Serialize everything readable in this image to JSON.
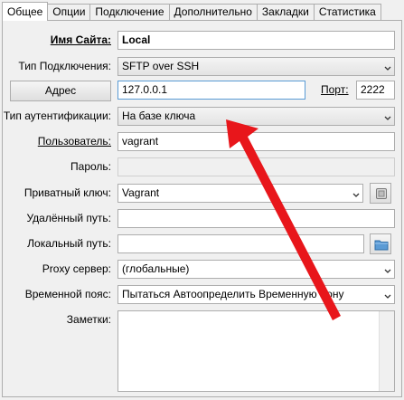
{
  "tabs": [
    "Общее",
    "Опции",
    "Подключение",
    "Дополнительно",
    "Закладки",
    "Статистика"
  ],
  "form": {
    "site_name_label": "Имя Сайта:",
    "site_name_value": "Local",
    "conn_type_label": "Тип Подключения:",
    "conn_type_value": "SFTP over SSH",
    "address_button": "Адрес",
    "address_value": "127.0.0.1",
    "port_label": "Порт:",
    "port_value": "2222",
    "auth_type_label": "Тип аутентификации:",
    "auth_type_value": "На базе ключа",
    "user_label": "Пользователь:",
    "user_value": "vagrant",
    "password_label": "Пароль:",
    "private_key_label": "Приватный ключ:",
    "private_key_value": "Vagrant",
    "remote_path_label": "Удалённый путь:",
    "remote_path_value": "",
    "local_path_label": "Локальный путь:",
    "local_path_value": "",
    "proxy_label": "Proxy сервер:",
    "proxy_value": "(глобальные)",
    "timezone_label": "Временной пояс:",
    "timezone_value": "Пытаться Автоопределить Временную Зону",
    "notes_label": "Заметки:"
  },
  "annotation": {
    "arrow_color": "#e8161b"
  },
  "icons": {
    "private_key_browse": "key-file-icon",
    "local_path_browse": "folder-icon"
  }
}
